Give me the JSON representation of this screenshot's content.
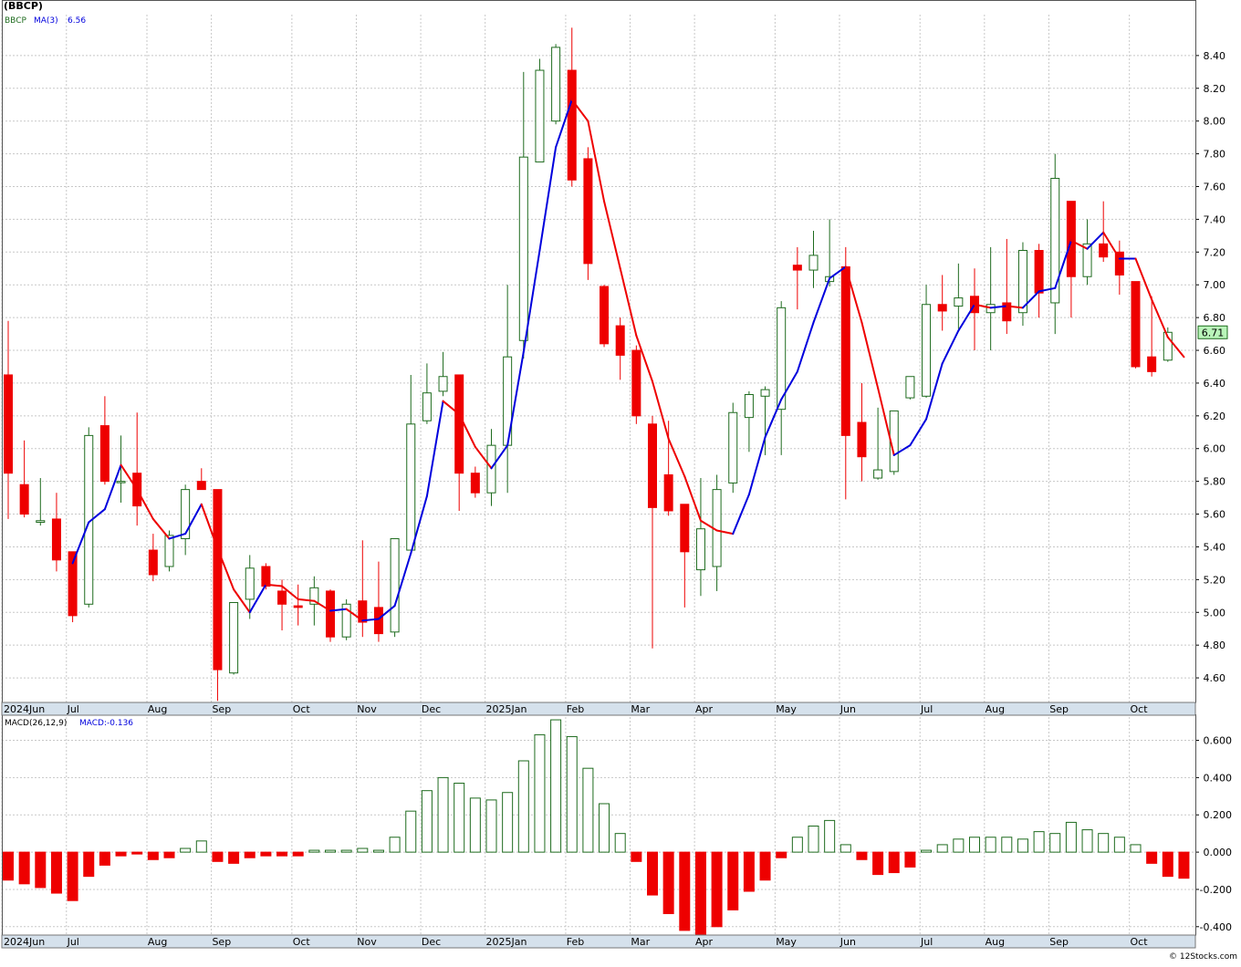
{
  "header": {
    "title": "(BBCP)",
    "legend_symbol": "BBCP",
    "legend_ma_label": "MA(3)",
    "legend_ma_value": "6.56",
    "macd_label": "MACD(26,12,9)",
    "macd_value_label": "MACD:-0.136",
    "last_price": "6.71",
    "credit": "© 12Stocks.com"
  },
  "colors": {
    "up": "#1e6b1e",
    "down": "#ee0000",
    "ma_up": "#0000dd",
    "ma_down": "#ee0000",
    "grid": "#c8c8c8",
    "axis_band": "#d5e1ec",
    "last_price_box": "#b9f5b9"
  },
  "chart_data": [
    {
      "type": "candlestick",
      "series_name": "BBCP",
      "ylim": [
        4.45,
        8.65
      ],
      "ytick_labels": [
        "4.60",
        "4.80",
        "5.00",
        "5.20",
        "5.40",
        "5.60",
        "5.80",
        "6.00",
        "6.20",
        "6.40",
        "6.60",
        "6.80",
        "7.00",
        "7.20",
        "7.40",
        "7.60",
        "7.80",
        "8.00",
        "8.20",
        "8.40"
      ],
      "month_labels": [
        "2024Jun",
        "Jul",
        "Aug",
        "Sep",
        "Oct",
        "Nov",
        "Dec",
        "2025Jan",
        "Feb",
        "Mar",
        "Apr",
        "May",
        "Jun",
        "Jul",
        "Aug",
        "Sep",
        "Oct"
      ],
      "month_start_index": [
        0,
        4,
        9,
        13,
        18,
        22,
        26,
        30,
        35,
        39,
        43,
        48,
        52,
        57,
        61,
        65,
        70
      ],
      "candles": [
        {
          "o": 6.45,
          "h": 6.78,
          "l": 5.57,
          "c": 5.85
        },
        {
          "o": 5.78,
          "h": 6.05,
          "l": 5.58,
          "c": 5.6
        },
        {
          "o": 5.55,
          "h": 5.82,
          "l": 5.53,
          "c": 5.56
        },
        {
          "o": 5.57,
          "h": 5.73,
          "l": 5.25,
          "c": 5.32
        },
        {
          "o": 5.37,
          "h": 5.37,
          "l": 4.94,
          "c": 4.98
        },
        {
          "o": 5.05,
          "h": 6.13,
          "l": 5.03,
          "c": 6.08
        },
        {
          "o": 6.14,
          "h": 6.32,
          "l": 5.78,
          "c": 5.8
        },
        {
          "o": 5.8,
          "h": 6.08,
          "l": 5.67,
          "c": 5.8
        },
        {
          "o": 5.85,
          "h": 6.22,
          "l": 5.53,
          "c": 5.65
        },
        {
          "o": 5.38,
          "h": 5.48,
          "l": 5.19,
          "c": 5.23
        },
        {
          "o": 5.28,
          "h": 5.5,
          "l": 5.25,
          "c": 5.47
        },
        {
          "o": 5.45,
          "h": 5.78,
          "l": 5.35,
          "c": 5.75
        },
        {
          "o": 5.8,
          "h": 5.88,
          "l": 5.75,
          "c": 5.75
        },
        {
          "o": 5.75,
          "h": 5.75,
          "l": 4.46,
          "c": 4.65
        },
        {
          "o": 4.63,
          "h": 5.06,
          "l": 4.62,
          "c": 5.06
        },
        {
          "o": 5.08,
          "h": 5.35,
          "l": 4.96,
          "c": 5.27
        },
        {
          "o": 5.28,
          "h": 5.3,
          "l": 5.14,
          "c": 5.16
        },
        {
          "o": 5.13,
          "h": 5.2,
          "l": 4.89,
          "c": 5.05
        },
        {
          "o": 5.04,
          "h": 5.17,
          "l": 4.92,
          "c": 5.03
        },
        {
          "o": 5.05,
          "h": 5.22,
          "l": 4.92,
          "c": 5.15
        },
        {
          "o": 5.13,
          "h": 5.14,
          "l": 4.82,
          "c": 4.85
        },
        {
          "o": 4.85,
          "h": 5.08,
          "l": 4.83,
          "c": 5.05
        },
        {
          "o": 5.07,
          "h": 5.44,
          "l": 4.85,
          "c": 4.94
        },
        {
          "o": 5.03,
          "h": 5.31,
          "l": 4.82,
          "c": 4.87
        },
        {
          "o": 4.88,
          "h": 5.44,
          "l": 4.85,
          "c": 5.45
        },
        {
          "o": 5.38,
          "h": 6.45,
          "l": 5.38,
          "c": 6.15
        },
        {
          "o": 6.17,
          "h": 6.52,
          "l": 6.15,
          "c": 6.34
        },
        {
          "o": 6.35,
          "h": 6.59,
          "l": 6.32,
          "c": 6.44
        },
        {
          "o": 6.45,
          "h": 6.45,
          "l": 5.62,
          "c": 5.85
        },
        {
          "o": 5.85,
          "h": 5.89,
          "l": 5.7,
          "c": 5.73
        },
        {
          "o": 5.73,
          "h": 6.12,
          "l": 5.65,
          "c": 6.02
        },
        {
          "o": 6.02,
          "h": 7.0,
          "l": 5.73,
          "c": 6.56
        },
        {
          "o": 6.66,
          "h": 8.3,
          "l": 6.55,
          "c": 7.78
        },
        {
          "o": 7.75,
          "h": 8.38,
          "l": 7.75,
          "c": 8.31
        },
        {
          "o": 8.0,
          "h": 8.47,
          "l": 7.98,
          "c": 8.45
        },
        {
          "o": 8.31,
          "h": 8.57,
          "l": 7.6,
          "c": 7.64
        },
        {
          "o": 7.77,
          "h": 7.84,
          "l": 7.03,
          "c": 7.13
        },
        {
          "o": 6.99,
          "h": 7.0,
          "l": 6.62,
          "c": 6.64
        },
        {
          "o": 6.75,
          "h": 6.8,
          "l": 6.42,
          "c": 6.57
        },
        {
          "o": 6.6,
          "h": 6.63,
          "l": 6.15,
          "c": 6.2
        },
        {
          "o": 6.15,
          "h": 6.2,
          "l": 4.78,
          "c": 5.64
        },
        {
          "o": 5.84,
          "h": 6.17,
          "l": 5.59,
          "c": 5.62
        },
        {
          "o": 5.66,
          "h": 5.66,
          "l": 5.03,
          "c": 5.37
        },
        {
          "o": 5.26,
          "h": 5.82,
          "l": 5.1,
          "c": 5.51
        },
        {
          "o": 5.28,
          "h": 5.84,
          "l": 5.13,
          "c": 5.75
        },
        {
          "o": 5.79,
          "h": 6.28,
          "l": 5.73,
          "c": 6.22
        },
        {
          "o": 6.19,
          "h": 6.35,
          "l": 5.98,
          "c": 6.33
        },
        {
          "o": 6.32,
          "h": 6.38,
          "l": 5.96,
          "c": 6.36
        },
        {
          "o": 6.24,
          "h": 6.9,
          "l": 5.96,
          "c": 6.86
        },
        {
          "o": 7.12,
          "h": 7.23,
          "l": 6.85,
          "c": 7.09
        },
        {
          "o": 7.09,
          "h": 7.33,
          "l": 6.98,
          "c": 7.18
        },
        {
          "o": 7.02,
          "h": 7.4,
          "l": 6.99,
          "c": 7.05
        },
        {
          "o": 7.11,
          "h": 7.23,
          "l": 5.69,
          "c": 6.08
        },
        {
          "o": 6.16,
          "h": 6.4,
          "l": 5.8,
          "c": 5.95
        },
        {
          "o": 5.82,
          "h": 6.25,
          "l": 5.81,
          "c": 5.87
        },
        {
          "o": 5.86,
          "h": 6.2,
          "l": 5.84,
          "c": 6.23
        },
        {
          "o": 6.31,
          "h": 6.44,
          "l": 6.3,
          "c": 6.44
        },
        {
          "o": 6.32,
          "h": 7.0,
          "l": 6.31,
          "c": 6.88
        },
        {
          "o": 6.88,
          "h": 7.06,
          "l": 6.72,
          "c": 6.84
        },
        {
          "o": 6.87,
          "h": 7.13,
          "l": 6.73,
          "c": 6.92
        },
        {
          "o": 6.93,
          "h": 7.1,
          "l": 6.6,
          "c": 6.83
        },
        {
          "o": 6.83,
          "h": 7.23,
          "l": 6.6,
          "c": 6.88
        },
        {
          "o": 6.89,
          "h": 7.28,
          "l": 6.7,
          "c": 6.78
        },
        {
          "o": 6.83,
          "h": 7.26,
          "l": 6.75,
          "c": 7.21
        },
        {
          "o": 7.21,
          "h": 7.25,
          "l": 6.8,
          "c": 6.95
        },
        {
          "o": 6.89,
          "h": 7.8,
          "l": 6.7,
          "c": 7.65
        },
        {
          "o": 7.51,
          "h": 7.51,
          "l": 6.8,
          "c": 7.05
        },
        {
          "o": 7.05,
          "h": 7.4,
          "l": 7.0,
          "c": 7.25
        },
        {
          "o": 7.25,
          "h": 7.51,
          "l": 7.14,
          "c": 7.17
        },
        {
          "o": 7.2,
          "h": 7.27,
          "l": 6.94,
          "c": 7.06
        },
        {
          "o": 7.02,
          "h": 7.02,
          "l": 6.49,
          "c": 6.5
        },
        {
          "o": 6.56,
          "h": 6.93,
          "l": 6.44,
          "c": 6.47
        },
        {
          "o": 6.54,
          "h": 6.74,
          "l": 6.53,
          "c": 6.71
        }
      ],
      "ma3": [
        null,
        null,
        null,
        null,
        5.3,
        5.55,
        5.63,
        5.9,
        5.75,
        5.57,
        5.45,
        5.48,
        5.66,
        5.39,
        5.14,
        5.0,
        5.17,
        5.16,
        5.08,
        5.07,
        5.01,
        5.02,
        4.95,
        4.96,
        5.04,
        5.36,
        5.71,
        6.29,
        6.21,
        6.01,
        5.88,
        6.02,
        6.59,
        7.21,
        7.84,
        8.13,
        8.0,
        7.51,
        7.1,
        6.69,
        6.41,
        6.06,
        5.83,
        5.56,
        5.5,
        5.48,
        5.72,
        6.07,
        6.3,
        6.47,
        6.77,
        7.04,
        7.11,
        6.77,
        6.37,
        5.96,
        6.02,
        6.18,
        6.52,
        6.72,
        6.88,
        6.86,
        6.87,
        6.86,
        6.96,
        6.98,
        7.27,
        7.22,
        7.32,
        7.16,
        7.16,
        6.91,
        6.68,
        6.56
      ],
      "macd_ylim": [
        -0.445,
        0.725
      ],
      "macd_ytick_labels": [
        "-0.400",
        "-0.200",
        "0.000",
        "0.200",
        "0.400",
        "0.600"
      ],
      "macd_hist": [
        -0.15,
        -0.17,
        -0.19,
        -0.22,
        -0.26,
        -0.13,
        -0.07,
        -0.02,
        -0.01,
        -0.04,
        -0.03,
        0.02,
        0.06,
        -0.05,
        -0.06,
        -0.03,
        -0.02,
        -0.02,
        -0.02,
        0.01,
        0.01,
        0.01,
        0.02,
        0.01,
        0.08,
        0.22,
        0.33,
        0.4,
        0.37,
        0.29,
        0.28,
        0.32,
        0.49,
        0.63,
        0.71,
        0.62,
        0.45,
        0.26,
        0.1,
        -0.05,
        -0.23,
        -0.33,
        -0.42,
        -0.45,
        -0.4,
        -0.31,
        -0.21,
        -0.15,
        -0.03,
        0.08,
        0.14,
        0.17,
        0.04,
        -0.04,
        -0.12,
        -0.11,
        -0.08,
        0.01,
        0.04,
        0.07,
        0.08,
        0.08,
        0.08,
        0.07,
        0.11,
        0.1,
        0.16,
        0.12,
        0.1,
        0.08,
        0.04,
        -0.06,
        -0.13,
        -0.14
      ]
    }
  ]
}
